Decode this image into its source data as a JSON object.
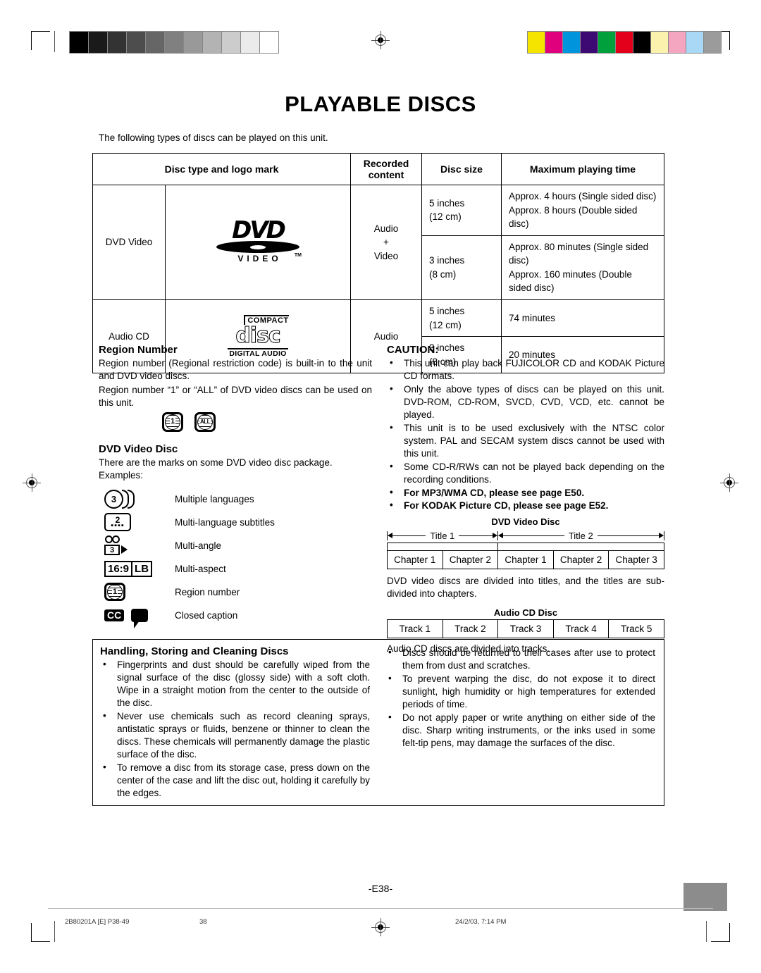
{
  "page": {
    "title": "PLAYABLE DISCS",
    "intro": "The following types of discs can be played on this unit.",
    "page_number_label": "-E38-"
  },
  "disc_table": {
    "headers": [
      "Disc type and logo mark",
      "Recorded content",
      "Disc size",
      "Maximum playing time"
    ],
    "rows": [
      {
        "type": "DVD Video",
        "logo": "dvd-video-logo",
        "logo_text": {
          "word": "DVD",
          "sub": "VIDEO",
          "tm": "TM"
        },
        "recorded": "Audio + Video",
        "recorded_line1": "Audio",
        "recorded_line2": "+",
        "recorded_line3": "Video",
        "sizes": [
          {
            "size_in": "5 inches",
            "size_cm": "(12 cm)",
            "times": [
              "Approx. 4 hours (Single sided disc)",
              "Approx. 8 hours (Double sided disc)"
            ]
          },
          {
            "size_in": "3 inches",
            "size_cm": "(8 cm)",
            "times": [
              "Approx. 80 minutes (Single sided disc)",
              "Approx. 160 minutes (Double sided disc)"
            ]
          }
        ]
      },
      {
        "type": "Audio CD",
        "logo": "compact-disc-digital-audio-logo",
        "logo_text": {
          "compact": "COMPACT",
          "disc": "disc",
          "digital": "DIGITAL AUDIO"
        },
        "recorded": "Audio",
        "sizes": [
          {
            "size_in": "5 inches",
            "size_cm": "(12 cm)",
            "times": [
              "74 minutes"
            ]
          },
          {
            "size_in": "3 inches",
            "size_cm": "(8 cm)",
            "times": [
              "20 minutes"
            ]
          }
        ]
      }
    ]
  },
  "region_number": {
    "heading": "Region Number",
    "p1": "Region number (Regional restriction code) is built-in to the unit and DVD video discs.",
    "p2": "Region number “1” or  “ALL” of DVD video discs can be used on this unit.",
    "icons": [
      {
        "name": "region-1-icon",
        "label": "1"
      },
      {
        "name": "region-all-icon",
        "label": "ALL"
      }
    ]
  },
  "dvd_video_disc": {
    "heading": "DVD Video Disc",
    "p1": "There are the marks on some DVD video disc package.",
    "p2": "Examples:",
    "marks": [
      {
        "icon": "multiple-languages-icon",
        "value": "3",
        "label": "Multiple languages"
      },
      {
        "icon": "multi-language-subtitles-icon",
        "value": "2",
        "label": "Multi-language subtitles"
      },
      {
        "icon": "multi-angle-icon",
        "value": "3",
        "label": "Multi-angle"
      },
      {
        "icon": "multi-aspect-icon",
        "value": "16:9",
        "value2": "LB",
        "label": "Multi-aspect"
      },
      {
        "icon": "region-number-icon",
        "value": "1",
        "label": "Region number"
      },
      {
        "icon": "closed-caption-icon",
        "value": "CC",
        "label": "Closed caption"
      }
    ]
  },
  "caution": {
    "heading": "CAUTION:",
    "items": [
      {
        "text": "This unit can play back FUJICOLOR CD and KODAK Picture CD formats.",
        "bold": false
      },
      {
        "text": "Only the above types of discs can be played on this unit. DVD-ROM, CD-ROM, SVCD, CVD, VCD, etc. cannot be played.",
        "bold": false
      },
      {
        "text": "This unit is to be used exclusively with the NTSC color system. PAL and SECAM system discs cannot be used with this unit.",
        "bold": false
      },
      {
        "text": "Some CD-R/RWs can not be played back depending on the recording conditions.",
        "bold": false
      },
      {
        "text": "For MP3/WMA CD, please see page E50.",
        "bold": true
      },
      {
        "text": "For KODAK Picture CD, please see page E52.",
        "bold": true
      }
    ]
  },
  "dvd_structure": {
    "title": "DVD Video Disc",
    "titles": [
      "Title 1",
      "Title 2"
    ],
    "chapters_title1": [
      "Chapter 1",
      "Chapter 2"
    ],
    "chapters_title2": [
      "Chapter 1",
      "Chapter 2",
      "Chapter 3"
    ],
    "caption": "DVD video discs are divided into titles, and the titles are sub-divided into chapters."
  },
  "cd_structure": {
    "title": "Audio CD Disc",
    "tracks": [
      "Track 1",
      "Track 2",
      "Track 3",
      "Track 4",
      "Track 5"
    ],
    "caption": "Audio CD discs are divided into tracks."
  },
  "handling": {
    "heading": "Handling, Storing and Cleaning Discs",
    "left_items": [
      "Fingerprints and dust should be carefully wiped from the signal surface of the disc (glossy side) with a soft cloth. Wipe in a straight motion from the center to the outside of the disc.",
      "Never use chemicals such as record cleaning sprays, antistatic sprays or fluids, benzene or thinner to clean the discs. These chemicals will permanently damage the plastic surface of the disc.",
      "To remove a disc from its storage case, press down on the center of the case and lift the disc out, holding it carefully by the edges."
    ],
    "right_items": [
      "Discs should be returned to their cases after use to protect them from dust and scratches.",
      "To prevent warping the disc, do not expose it to direct sunlight, high humidity or high temperatures for extended periods of time.",
      "Do not apply paper or write anything on either side of the disc. Sharp writing instruments, or the inks used in some felt-tip pens, may damage the surfaces of the disc."
    ]
  },
  "footer": {
    "doc_id": "2B80201A [E] P38-49",
    "sheet_number": "38",
    "timestamp": "24/2/03, 7:14 PM"
  },
  "print_marks": {
    "grayscale_wedge": [
      "#000000",
      "#1a1a1a",
      "#333333",
      "#4d4d4d",
      "#666666",
      "#808080",
      "#999999",
      "#b3b3b3",
      "#cccccc",
      "#ebebeb",
      "#ffffff"
    ],
    "color_bar": [
      "#f5e400",
      "#e0007d",
      "#0094dd",
      "#3d0a73",
      "#00a03c",
      "#e2001a",
      "#000000",
      "#fbf2ae",
      "#f4a6c0",
      "#a8d8f5",
      "#9b9b9b"
    ]
  }
}
